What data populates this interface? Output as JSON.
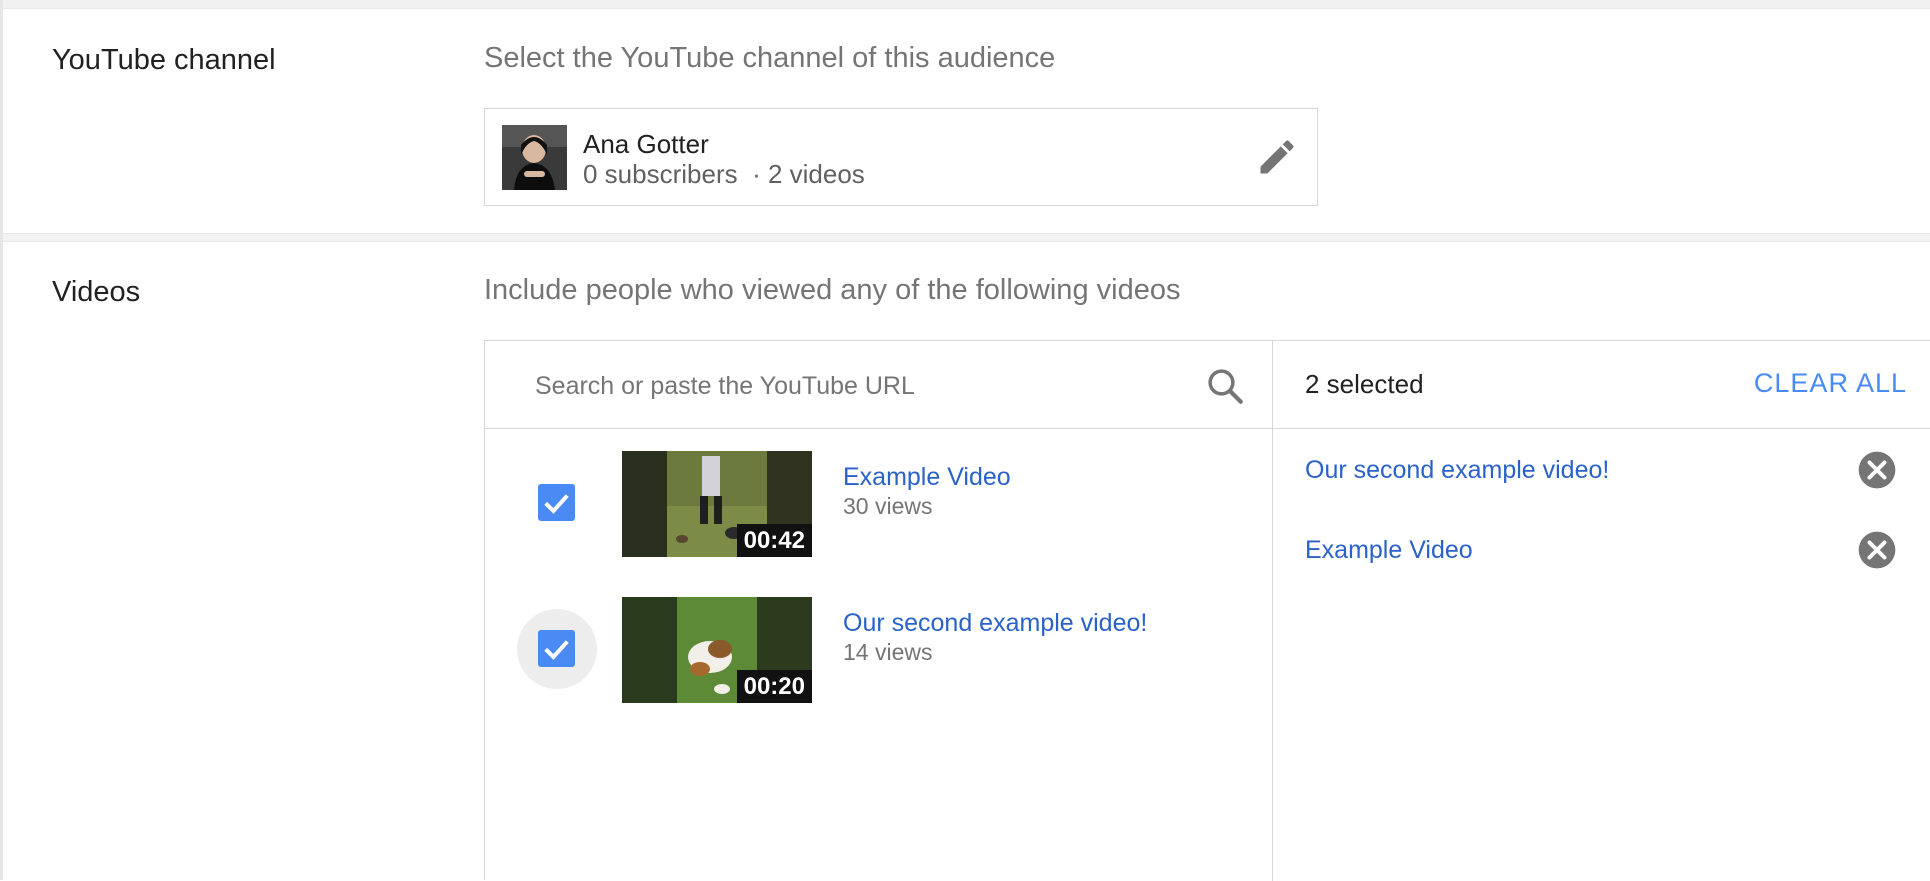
{
  "channel_section": {
    "label": "YouTube channel",
    "description": "Select the YouTube channel of this audience",
    "channel": {
      "name": "Ana Gotter",
      "meta": "0 subscribers  · 2 videos",
      "avatar_icon": "channel-avatar",
      "edit_icon": "pencil-icon"
    }
  },
  "videos_section": {
    "label": "Videos",
    "description": "Include people who viewed any of the following videos",
    "search": {
      "placeholder": "Search or paste the YouTube URL",
      "value": "",
      "icon": "search-icon"
    },
    "results": [
      {
        "title": "Example Video",
        "views": "30 views",
        "duration": "00:42",
        "checked": true
      },
      {
        "title": "Our second example video!",
        "views": "14 views",
        "duration": "00:20",
        "checked": true
      }
    ],
    "selected": {
      "count_label": "2 selected",
      "clear_label": "CLEAR ALL",
      "items": [
        {
          "title": "Our second example video!"
        },
        {
          "title": "Example Video"
        }
      ],
      "remove_icon": "close-circle-icon"
    }
  },
  "colors": {
    "link_blue": "#2a62c9",
    "accent_blue": "#4a8af4",
    "muted_text": "#757575",
    "border": "#d6d6d6"
  }
}
